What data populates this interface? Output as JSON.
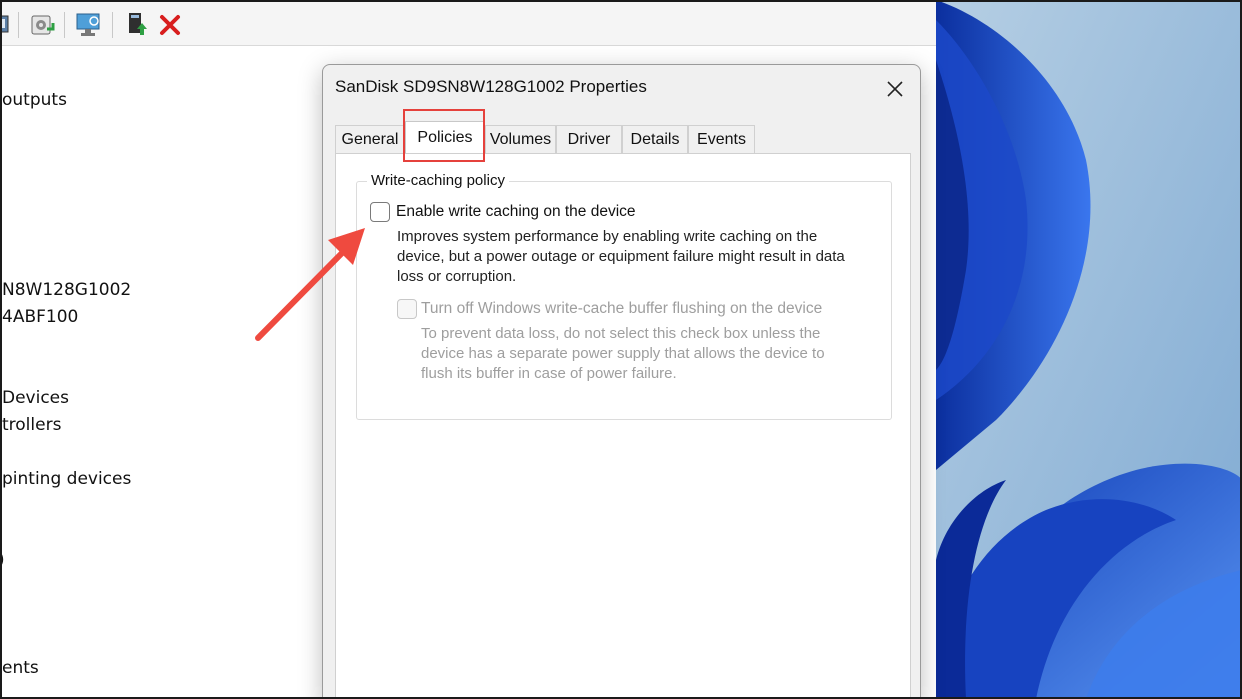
{
  "device_manager": {
    "tree_items": [
      "outputs",
      "N8W128G1002",
      "4ABF100",
      "Devices",
      "trollers",
      "pinting devices",
      ")",
      "ents"
    ]
  },
  "dialog": {
    "title": "SanDisk SD9SN8W128G1002 Properties",
    "tabs": [
      "General",
      "Policies",
      "Volumes",
      "Driver",
      "Details",
      "Events"
    ],
    "active_tab": "Policies",
    "group_label": "Write-caching policy",
    "enable_write_caching": {
      "label": "Enable write caching on the device",
      "checked": false,
      "description_lines": [
        "Improves system performance by enabling write caching on the",
        "device, but a power outage or equipment failure might result in data",
        "loss or corruption."
      ]
    },
    "turn_off_flushing": {
      "label": "Turn off Windows write-cache buffer flushing on the device",
      "checked": false,
      "disabled": true,
      "description_lines": [
        "To prevent data loss, do not select this check box unless the",
        "device has a separate power supply that allows the device to",
        "flush its buffer in case of power failure."
      ]
    }
  },
  "icons": {
    "toolbar": [
      "device-icon",
      "update-driver-icon",
      "scan-hardware-icon",
      "enable-device-icon",
      "uninstall-device-icon"
    ],
    "close": "close-icon"
  },
  "colors": {
    "highlight": "#e5413c",
    "arrow": "#ef4a3f",
    "wallpaper_base": "#9cc0de",
    "wallpaper_bloom": "#1f4fd0"
  }
}
